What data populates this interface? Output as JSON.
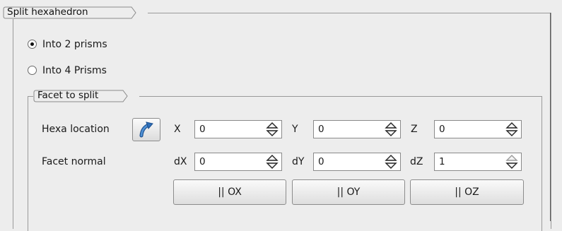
{
  "split_group": {
    "title": "Split hexahedron",
    "options": [
      {
        "label": "Into 2 prisms",
        "checked": true
      },
      {
        "label": "Into 4 Prisms",
        "checked": false
      }
    ]
  },
  "facet_group": {
    "title": "Facet to split",
    "hexa_location": {
      "label": "Hexa location",
      "icon": "curved-arrow-select-icon",
      "fields": [
        {
          "label": "X",
          "value": "0"
        },
        {
          "label": "Y",
          "value": "0"
        },
        {
          "label": "Z",
          "value": "0"
        }
      ]
    },
    "facet_normal": {
      "label": "Facet normal",
      "fields": [
        {
          "label": "dX",
          "value": "0"
        },
        {
          "label": "dY",
          "value": "0"
        },
        {
          "label": "dZ",
          "value": "1"
        }
      ]
    },
    "axis_buttons": [
      {
        "label": "|| OX"
      },
      {
        "label": "|| OY"
      },
      {
        "label": "|| OZ"
      }
    ]
  },
  "colors": {
    "background": "#ededed",
    "icon_blue": "#2f6fb7"
  }
}
